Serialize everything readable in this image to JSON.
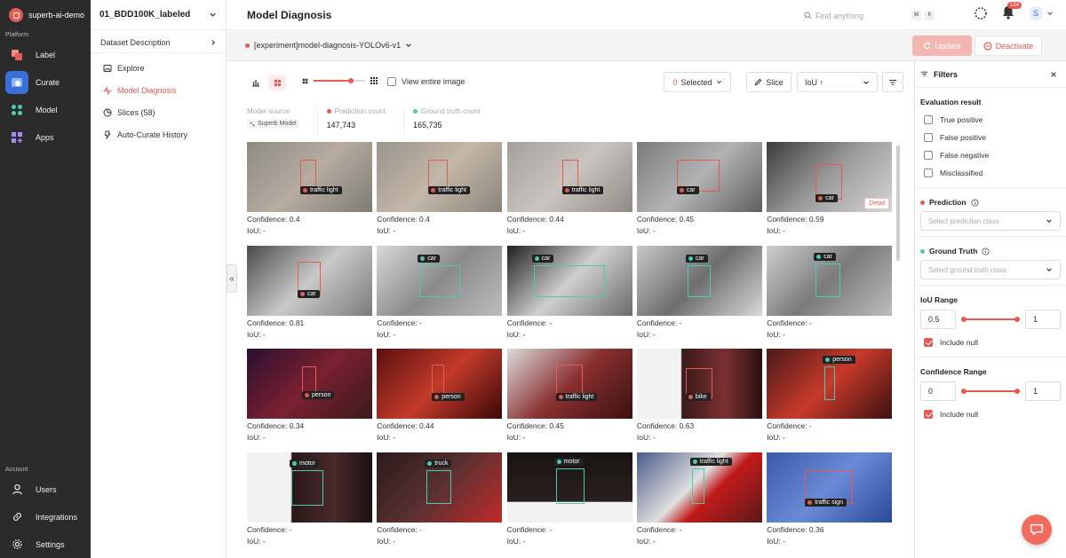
{
  "sidebar": {
    "org": "superb-ai-demo",
    "platform_label": "Platform",
    "items": [
      {
        "label": "Label",
        "icon": "label-icon",
        "active": false
      },
      {
        "label": "Curate",
        "icon": "curate-icon",
        "active": true
      },
      {
        "label": "Model",
        "icon": "model-icon",
        "active": false
      },
      {
        "label": "Apps",
        "icon": "apps-icon",
        "active": false
      }
    ],
    "account_label": "Account",
    "bottom_items": [
      {
        "label": "Users",
        "icon": "user-icon"
      },
      {
        "label": "Integrations",
        "icon": "link-icon"
      },
      {
        "label": "Settings",
        "icon": "gear-icon"
      }
    ]
  },
  "dataset": {
    "name": "01_BDD100K_labeled",
    "description_label": "Dataset Description",
    "nav": [
      {
        "label": "Explore",
        "icon": "image-icon",
        "active": false
      },
      {
        "label": "Model Diagnosis",
        "icon": "pulse-icon",
        "active": true
      },
      {
        "label": "Slices (58)",
        "icon": "slices-icon",
        "active": false
      },
      {
        "label": "Auto-Curate History",
        "icon": "history-icon",
        "active": false
      }
    ]
  },
  "header": {
    "title": "Model Diagnosis",
    "search_placeholder": "Find anything",
    "kbd1": "⌘",
    "kbd2": "K",
    "notification_count": "124",
    "avatar": "S"
  },
  "experiment": {
    "name": "[experiment]model-diagnosis-YOLOv6-v1",
    "update_label": "Update",
    "deactivate_label": "Deactivate"
  },
  "toolbar": {
    "view_entire_label": "View entire image",
    "selected_count": "0",
    "selected_label": "Selected",
    "slice_label": "Slice",
    "sort_label": "IoU ↑",
    "zoom_level": 0.72
  },
  "stats": {
    "model_source_label": "Model source",
    "model_source_value": "Superb Model",
    "prediction_label": "Prediction count",
    "prediction_value": "147,743",
    "gt_label": "Ground truth count",
    "gt_value": "165,735"
  },
  "colors": {
    "accent": "#e55b52",
    "prediction": "#e55b52",
    "ground_truth": "#4fc9b0"
  },
  "cards": [
    {
      "label": "traffic light",
      "type": "pred",
      "conf": "Confidence: 0.4",
      "iou": "IoU: -",
      "bg": "linear-gradient(135deg,#8f8a83,#b6ada0 50%,#7f7a73)"
    },
    {
      "label": "traffic light",
      "type": "pred",
      "conf": "Confidence: 0.4",
      "iou": "IoU: -",
      "bg": "linear-gradient(135deg,#9a948b,#c2b8a8 50%,#8a8479)"
    },
    {
      "label": "traffic light",
      "type": "pred",
      "conf": "Confidence: 0.44",
      "iou": "IoU: -",
      "bg": "linear-gradient(135deg,#a4a09a,#c9c4bd 50%,#8e8a84)"
    },
    {
      "label": "car",
      "type": "pred",
      "conf": "Confidence: 0.45",
      "iou": "IoU: -",
      "bg": "linear-gradient(135deg,#7b7b7b,#b3b3b3 50%,#5f5f5f)"
    },
    {
      "label": "car",
      "type": "pred",
      "conf": "Confidence: 0.59",
      "iou": "IoU: -",
      "bg": "linear-gradient(135deg,#3c3c3c,#9b9b9b 50%,#d6d6d6)",
      "detail": "Detail"
    },
    {
      "label": "car",
      "type": "pred",
      "conf": "Confidence: 0.81",
      "iou": "IoU: -",
      "bg": "linear-gradient(135deg,#4a4a4a,#c9c9c9 50%,#7a7a7a)"
    },
    {
      "label": "car",
      "type": "gt",
      "conf": "Confidence: -",
      "iou": "IoU: -",
      "bg": "linear-gradient(135deg,#d9d9d9,#8a8a8a 50%,#bdbdbd)"
    },
    {
      "label": "car",
      "type": "gt",
      "conf": "Confidence: -",
      "iou": "IoU: -",
      "bg": "linear-gradient(135deg,#1f1f1f,#cfcfcf 50%,#6a6a6a)"
    },
    {
      "label": "car",
      "type": "gt",
      "conf": "Confidence: -",
      "iou": "IoU: -",
      "bg": "linear-gradient(135deg,#c8c8c8,#6e6e6e 50%,#d8d8d8)"
    },
    {
      "label": "car",
      "type": "gt",
      "conf": "Confidence: -",
      "iou": "IoU: -",
      "bg": "linear-gradient(135deg,#cfcfcf,#7a7a7a 50%,#bdbdbd)"
    },
    {
      "label": "person",
      "type": "pred",
      "conf": "Confidence: 0.34",
      "iou": "IoU: -",
      "bg": "linear-gradient(135deg,#2a1030,#7a2030 50%,#3a1a1a)"
    },
    {
      "label": "person",
      "type": "pred",
      "conf": "Confidence: 0.44",
      "iou": "IoU: -",
      "bg": "linear-gradient(135deg,#5a1010,#c23a2a 50%,#3a0808)"
    },
    {
      "label": "traffic light",
      "type": "pred",
      "conf": "Confidence: 0.45",
      "iou": "IoU: -",
      "bg": "linear-gradient(135deg,#dcdcdc,#8a3030 50%,#3a1010)"
    },
    {
      "label": "bike",
      "type": "pred",
      "conf": "Confidence: 0.63",
      "iou": "IoU: -",
      "bg": "linear-gradient(90deg,#f2f2f2 35%,#3a1a1a 36%,#7a3030 70%,#2a1010)"
    },
    {
      "label": "person",
      "type": "gt",
      "conf": "Confidence: -",
      "iou": "IoU: -",
      "bg": "linear-gradient(135deg,#4a1a1a,#c83a2a 50%,#3a1010)"
    },
    {
      "label": "motor",
      "type": "gt",
      "conf": "Confidence: -",
      "iou": "IoU: -",
      "bg": "linear-gradient(90deg,#f2f2f2 35%,#2a1818 36%,#4a2a2a 70%,#1a1010)"
    },
    {
      "label": "truck",
      "type": "gt",
      "conf": "Confidence: -",
      "iou": "IoU: -",
      "bg": "linear-gradient(135deg,#2a1a1a,#5a3030 50%,#c22a2a)"
    },
    {
      "label": "motor",
      "type": "gt",
      "conf": "Confidence: -",
      "iou": "IoU: -",
      "bg": "linear-gradient(180deg,#1a1212 0%,#2a2020 70%,#f2f2f2 71%)"
    },
    {
      "label": "traffic light",
      "type": "gt",
      "conf": "Confidence: -",
      "iou": "IoU: -",
      "bg": "linear-gradient(135deg,#4a5a8a,#e0e0e0 45%,#c21a1a 60%,#5a1a1a)"
    },
    {
      "label": "traffic sign",
      "type": "pred",
      "conf": "Confidence: 0.36",
      "iou": "IoU: -",
      "bg": "linear-gradient(135deg,#3a5aa8,#6a8ad8 50%,#2a4a98)"
    }
  ],
  "filters": {
    "title": "Filters",
    "eval_title": "Evaluation result",
    "eval_options": [
      "True positive",
      "False positive",
      "False negative",
      "Misclassified"
    ],
    "prediction_title": "Prediction",
    "prediction_placeholder": "Select prediction class",
    "gt_title": "Ground Truth",
    "gt_placeholder": "Select ground truth class",
    "iou_title": "IoU Range",
    "iou_min": "0.5",
    "iou_max": "1",
    "include_null": "Include null",
    "conf_title": "Confidence Range",
    "conf_min": "0",
    "conf_max": "1"
  }
}
